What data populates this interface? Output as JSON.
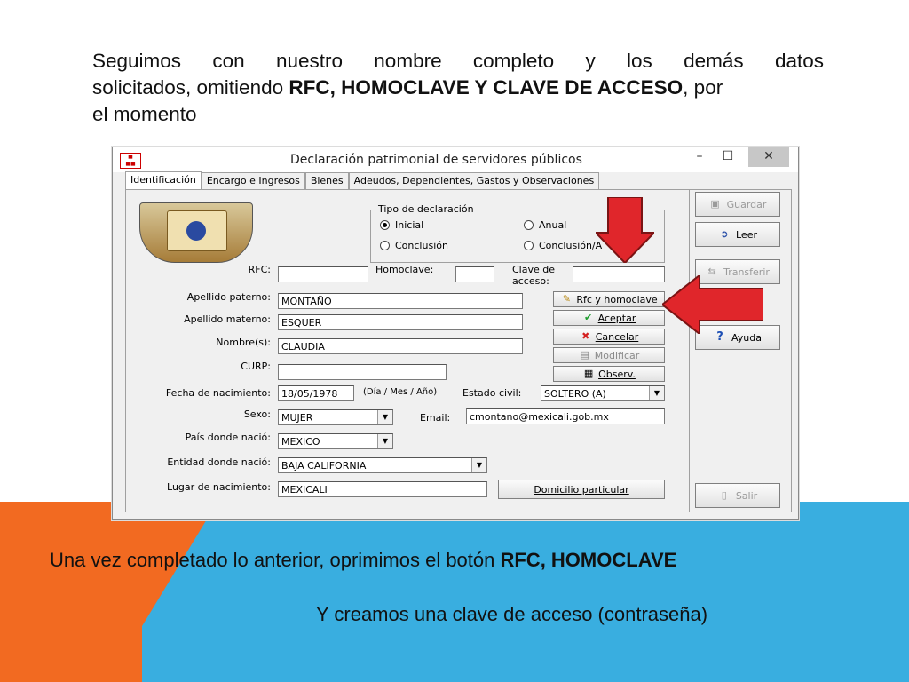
{
  "slide": {
    "intro_line1": [
      "Seguimos",
      "con",
      "nuestro",
      "nombre",
      "completo",
      "y",
      "los",
      "demás",
      "datos"
    ],
    "intro_pre": "solicitados, omitiendo ",
    "intro_bold": "RFC, HOMOCLAVE Y CLAVE DE ACCESO",
    "intro_post": ", por",
    "intro_line3": "el momento",
    "caption1_pre": "Una vez completado lo anterior, oprimimos el botón ",
    "caption1_bold": "RFC, HOMOCLAVE",
    "caption2": "Y creamos una clave de acceso (contraseña)",
    "colors": {
      "orange": "#f26a21",
      "blue": "#39aee0",
      "arrow_red": "#e0262b"
    }
  },
  "window": {
    "title": "Declaración patrimonial de servidores públicos",
    "minimize_glyph": "–",
    "maximize_glyph": "☐",
    "close_glyph": "✕",
    "tabs": [
      "Identificación",
      "Encargo e Ingresos",
      "Bienes",
      "Adeudos, Dependientes, Gastos y Observaciones"
    ],
    "tipo": {
      "title": "Tipo de declaración",
      "inicial": "Inicial",
      "anual": "Anual",
      "conclusion": "Conclusión",
      "conclusion2": "Conclusión/A"
    },
    "labels": {
      "rfc": "RFC:",
      "homoclave": "Homoclave:",
      "clave": "Clave de\nacceso:",
      "apellido_paterno": "Apellido paterno:",
      "apellido_materno": "Apellido materno:",
      "nombres": "Nombre(s):",
      "curp": "CURP:",
      "fecha": "Fecha de nacimiento:",
      "fecha_fmt": "(Día / Mes / Año)",
      "estado_civil": "Estado civil:",
      "sexo": "Sexo:",
      "email": "Email:",
      "pais": "País donde nació:",
      "entidad": "Entidad donde nació:",
      "lugar": "Lugar de nacimiento:"
    },
    "values": {
      "rfc": "",
      "homoclave": "",
      "clave": "",
      "apellido_paterno": "MONTAÑO",
      "apellido_materno": "ESQUER",
      "nombres": "CLAUDIA",
      "curp": "",
      "fecha": "18/05/1978",
      "estado_civil": "SOLTERO (A)",
      "sexo": "MUJER",
      "email": "cmontano@mexicali.gob.mx",
      "pais": "MEXICO",
      "entidad": "BAJA CALIFORNIA",
      "lugar": "MEXICALI"
    },
    "buttons": {
      "rfc_homoclave": "Rfc y homoclave",
      "aceptar": "Aceptar",
      "cancelar": "Cancelar",
      "modificar": "Modificar",
      "observ": "Observ.",
      "domicilio": "Domicilio particular"
    },
    "side_buttons": {
      "guardar": "Guardar",
      "leer": "Leer",
      "transferir": "Transferir",
      "ayuda": "Ayuda",
      "salir": "Salir"
    }
  }
}
